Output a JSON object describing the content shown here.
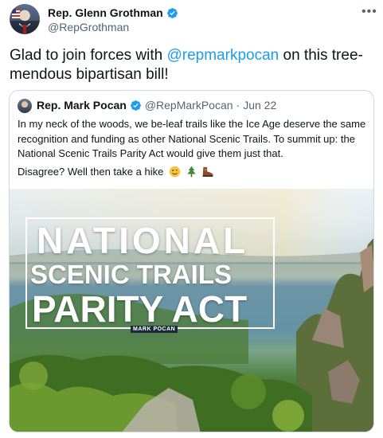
{
  "author": {
    "display_name": "Rep. Glenn Grothman",
    "handle": "@RepGrothman"
  },
  "tweet": {
    "text_before": "Glad to join forces with ",
    "mention": "@repmarkpocan",
    "text_after": " on this tree-mendous bipartisan bill!"
  },
  "quoted": {
    "display_name": "Rep. Mark Pocan",
    "handle": "@RepMarkPocan",
    "separator": "·",
    "date": "Jun 22",
    "paragraph1": "In my neck of the woods, we be-leaf trails like the Ice Age deserve the same recognition and funding as other National Scenic Trails. To summit up: the National Scenic Trails Parity Act would give them just that.",
    "paragraph2": "Disagree? Well then take a hike",
    "emojis": [
      "winking-face",
      "evergreen-tree",
      "hiking-boot"
    ],
    "image": {
      "title_line1": "NATIONAL",
      "title_line2": "SCENIC TRAILS",
      "title_line3": "PARITY ACT",
      "credit": "MARK POCAN"
    }
  },
  "icons": {
    "verified": "verified-badge-icon",
    "more": "more-options-icon"
  },
  "colors": {
    "accent": "#1d9bf0",
    "text": "#0f1419",
    "secondary": "#536471",
    "border": "#cfd9de"
  }
}
